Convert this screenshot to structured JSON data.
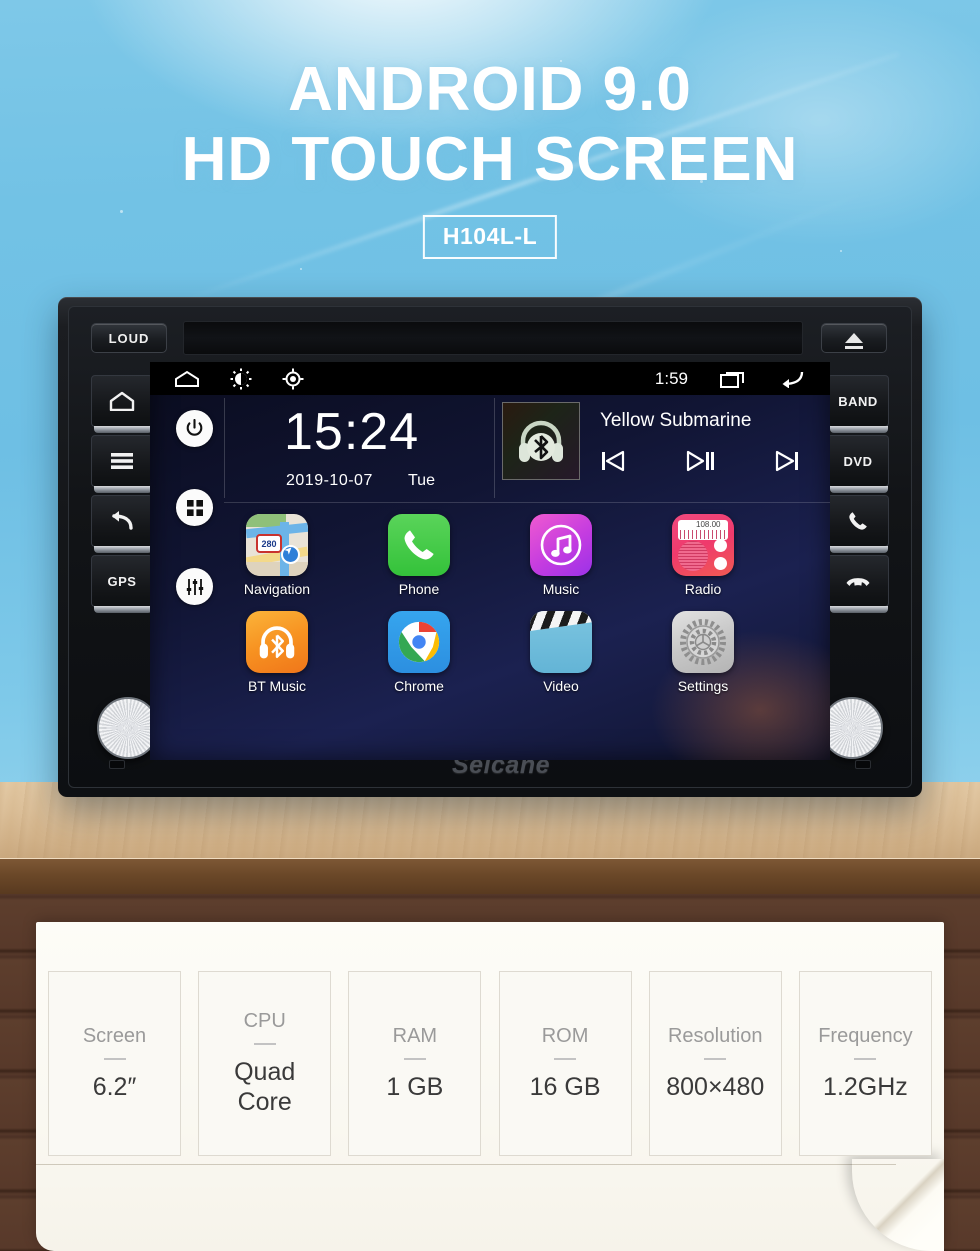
{
  "hero": {
    "line1": "ANDROID 9.0",
    "line2": "HD TOUCH SCREEN",
    "model_badge": "H104L-L"
  },
  "device": {
    "brand": "Seicane",
    "top_bezel": {
      "loud_button": "LOUD",
      "eject_icon": "eject-icon",
      "disc_slot": "disc-slot"
    },
    "left_buttons": [
      {
        "label": "",
        "icon": "home-icon"
      },
      {
        "label": "",
        "icon": "menu-icon"
      },
      {
        "label": "",
        "icon": "back-icon"
      },
      {
        "label": "GPS",
        "icon": ""
      }
    ],
    "right_buttons": [
      {
        "label": "BAND",
        "icon": ""
      },
      {
        "label": "DVD",
        "icon": ""
      },
      {
        "label": "",
        "icon": "phone-answer-icon"
      },
      {
        "label": "",
        "icon": "phone-hangup-icon"
      }
    ],
    "left_knob": "volume-knob",
    "right_knob": "tune-knob"
  },
  "screen": {
    "statusbar": {
      "left_icons": [
        "home-icon",
        "brightness-icon",
        "gps-icon"
      ],
      "time": "1:59",
      "right_icons": [
        "recents-icon",
        "back-icon"
      ]
    },
    "side_icons": [
      "power-icon",
      "apps-grid-icon",
      "equalizer-icon"
    ],
    "clock": {
      "time": "15:24",
      "date": "2019-10-07",
      "weekday": "Tue"
    },
    "media": {
      "album_art_icon": "bluetooth-headphones-icon",
      "song_title": "Yellow Submarine",
      "controls": [
        "prev-track-icon",
        "play-pause-icon",
        "next-track-icon"
      ]
    },
    "apps": [
      [
        {
          "label": "Navigation",
          "icon": "navigation-icon",
          "badge": "280"
        },
        {
          "label": "Phone",
          "icon": "phone-icon"
        },
        {
          "label": "Music",
          "icon": "music-icon"
        },
        {
          "label": "Radio",
          "icon": "radio-icon",
          "freq": "108.00"
        }
      ],
      [
        {
          "label": "BT Music",
          "icon": "bluetooth-music-icon"
        },
        {
          "label": "Chrome",
          "icon": "chrome-icon"
        },
        {
          "label": "Video",
          "icon": "video-icon"
        },
        {
          "label": "Settings",
          "icon": "settings-icon"
        }
      ]
    ]
  },
  "specs": [
    {
      "label": "Screen",
      "value": "6.2″"
    },
    {
      "label": "CPU",
      "value": "Quad\nCore"
    },
    {
      "label": "RAM",
      "value": "1 GB"
    },
    {
      "label": "ROM",
      "value": "16 GB"
    },
    {
      "label": "Resolution",
      "value": "800×480"
    },
    {
      "label": "Frequency",
      "value": "1.2GHz"
    }
  ],
  "colors": {
    "sky": "#6ec1e4",
    "headline": "#ffffff",
    "shelf_top": "#dcc09a",
    "shelf_edge": "#6b4828",
    "wall": "#4b3022",
    "page": "#faf8f1",
    "spec_label": "#9a9a9a",
    "spec_value": "#3a3a3a"
  }
}
